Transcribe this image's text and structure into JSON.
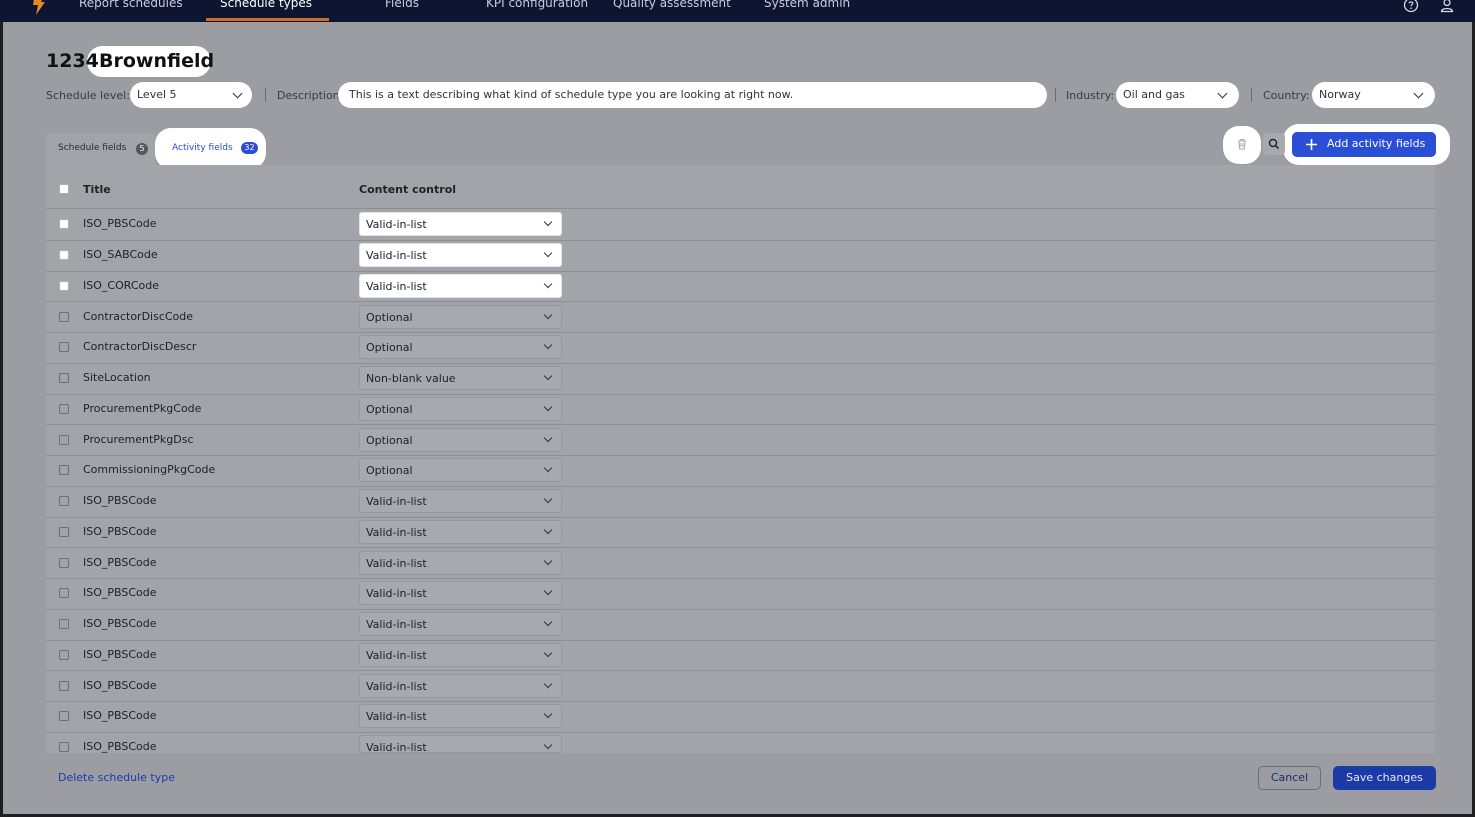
{
  "nav": {
    "items": [
      "Report schedules",
      "Schedule types",
      "Fields",
      "KPI configuration",
      "Quality assessment",
      "System admin"
    ],
    "active_index": 1,
    "help_icon": "help-circle-icon",
    "user_icon": "user-icon"
  },
  "header": {
    "id": "1234",
    "name": "Brownfield"
  },
  "filters": {
    "schedule_level_label": "Schedule level:",
    "schedule_level_value": "Level 5",
    "description_label": "Description:",
    "description_value": "This is a text describing what kind of  schedule type you are looking at right now.",
    "industry_label": "Industry:",
    "industry_value": "Oil and gas",
    "country_label": "Country:",
    "country_value": "Norway"
  },
  "tabs": [
    {
      "label": "Schedule fields",
      "count": "5"
    },
    {
      "label": "Activity fields",
      "count": "32"
    }
  ],
  "active_tab": 1,
  "toolbar": {
    "delete_icon": "trash-icon",
    "search_icon": "search-icon",
    "add_label": "Add activity fields"
  },
  "table": {
    "columns": [
      "Title",
      "Content control"
    ],
    "rows": [
      {
        "title": "ISO_PBSCode",
        "control": "Valid-in-list"
      },
      {
        "title": "ISO_SABCode",
        "control": "Valid-in-list"
      },
      {
        "title": "ISO_CORCode",
        "control": "Valid-in-list"
      },
      {
        "title": "ContractorDiscCode",
        "control": "Optional"
      },
      {
        "title": "ContractorDiscDescr",
        "control": "Optional"
      },
      {
        "title": "SiteLocation",
        "control": "Non-blank value"
      },
      {
        "title": "ProcurementPkgCode",
        "control": "Optional"
      },
      {
        "title": "ProcurementPkgDsc",
        "control": "Optional"
      },
      {
        "title": "CommissioningPkgCode",
        "control": "Optional"
      },
      {
        "title": "ISO_PBSCode",
        "control": "Valid-in-list"
      },
      {
        "title": "ISO_PBSCode",
        "control": "Valid-in-list"
      },
      {
        "title": "ISO_PBSCode",
        "control": "Valid-in-list"
      },
      {
        "title": "ISO_PBSCode",
        "control": "Valid-in-list"
      },
      {
        "title": "ISO_PBSCode",
        "control": "Valid-in-list"
      },
      {
        "title": "ISO_PBSCode",
        "control": "Valid-in-list"
      },
      {
        "title": "ISO_PBSCode",
        "control": "Valid-in-list"
      },
      {
        "title": "ISO_PBSCode",
        "control": "Valid-in-list"
      },
      {
        "title": "ISO_PBSCode",
        "control": "Valid-in-list"
      }
    ]
  },
  "footer": {
    "delete_label": "Delete schedule type",
    "cancel_label": "Cancel",
    "save_label": "Save changes"
  },
  "colors": {
    "nav_bg": "#0e1530",
    "accent": "#2a4fd6",
    "underline": "#d2691e",
    "overlay": "#9c9da3"
  }
}
